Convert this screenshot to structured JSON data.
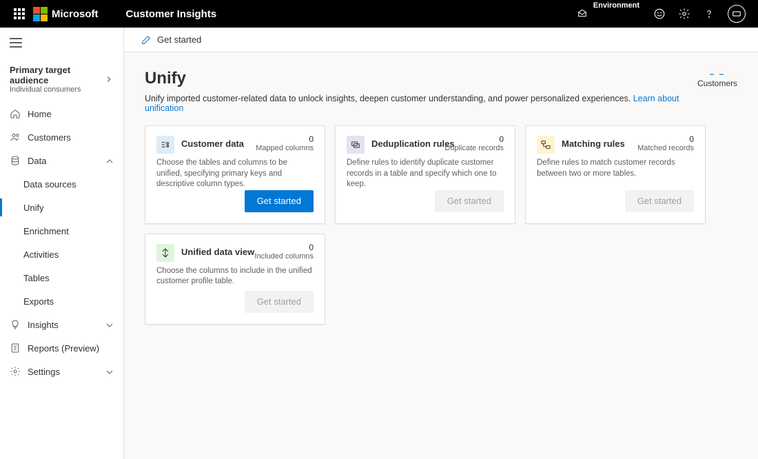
{
  "topbar": {
    "brand": "Microsoft",
    "product": "Customer Insights",
    "env_label": "Environment"
  },
  "nav": {
    "primary_title": "Primary target audience",
    "primary_subtitle": "Individual consumers",
    "items": {
      "home": "Home",
      "customers": "Customers",
      "data": "Data",
      "data_children": {
        "sources": "Data sources",
        "unify": "Unify",
        "enrichment": "Enrichment",
        "activities": "Activities",
        "tables": "Tables",
        "exports": "Exports"
      },
      "insights": "Insights",
      "reports": "Reports (Preview)",
      "settings": "Settings"
    }
  },
  "cmdbar": {
    "get_started": "Get started"
  },
  "page": {
    "title": "Unify",
    "desc": "Unify imported customer-related data to unlock insights, deepen customer understanding, and power personalized experiences. ",
    "learn_link": "Learn about unification",
    "customers_label": "Customers",
    "customers_value": "– –"
  },
  "cards": [
    {
      "title": "Customer data",
      "metric_value": "0",
      "metric_label": "Mapped columns",
      "desc": "Choose the tables and columns to be unified, specifying primary keys and descriptive column types.",
      "button": "Get started",
      "button_kind": "primary",
      "icon_bg": "ic-bg-blue"
    },
    {
      "title": "Deduplication rules",
      "metric_value": "0",
      "metric_label": "Duplicate records",
      "desc": "Define rules to identify duplicate customer records in a table and specify which one to keep.",
      "button": "Get started",
      "button_kind": "disabled",
      "icon_bg": "ic-bg-purple"
    },
    {
      "title": "Matching rules",
      "metric_value": "0",
      "metric_label": "Matched records",
      "desc": "Define rules to match customer records between two or more tables.",
      "button": "Get started",
      "button_kind": "disabled",
      "icon_bg": "ic-bg-yellow"
    },
    {
      "title": "Unified data view",
      "metric_value": "0",
      "metric_label": "Included columns",
      "desc": "Choose the columns to include in the unified customer profile table.",
      "button": "Get started",
      "button_kind": "disabled",
      "icon_bg": "ic-bg-green"
    }
  ]
}
